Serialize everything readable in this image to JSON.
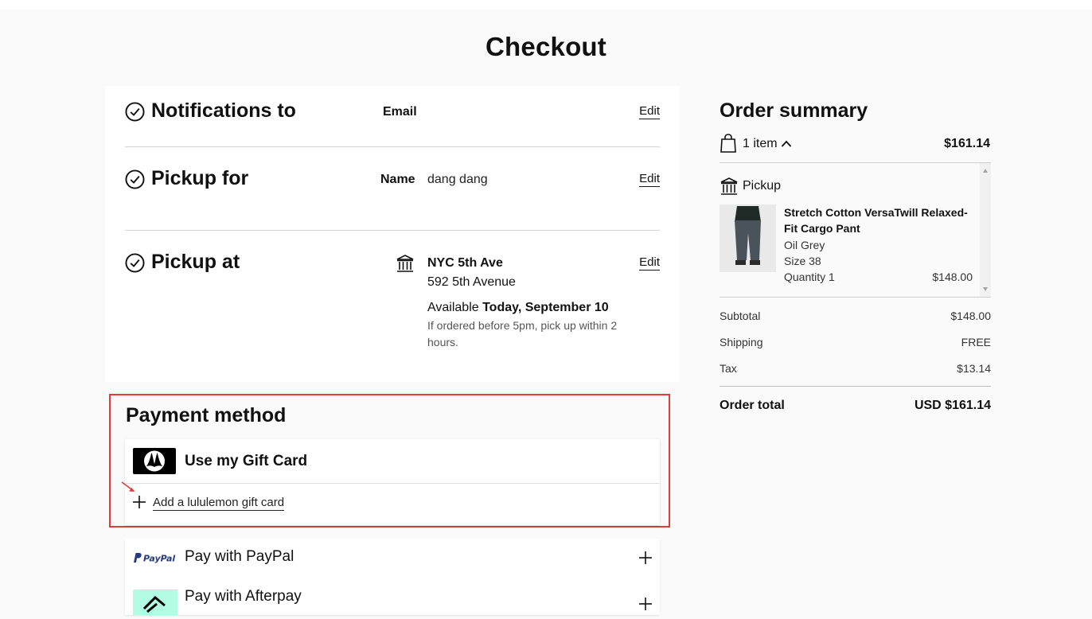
{
  "page": {
    "title": "Checkout"
  },
  "notifications": {
    "title": "Notifications to",
    "label": "Email",
    "edit": "Edit"
  },
  "pickup_for": {
    "title": "Pickup for",
    "label": "Name",
    "value": "dang dang",
    "edit": "Edit"
  },
  "pickup_at": {
    "title": "Pickup at",
    "store_name": "NYC 5th Ave",
    "address": "592 5th Avenue",
    "available_prefix": "Available",
    "available_when": "Today, September 10",
    "note": "If ordered before 5pm, pick up within 2 hours.",
    "edit": "Edit"
  },
  "payment": {
    "title": "Payment method",
    "gift_card": {
      "title": "Use my Gift Card",
      "add_link": "Add a lululemon gift card"
    },
    "options": [
      {
        "label": "Pay with PayPal",
        "logo_text": "PayPal"
      },
      {
        "label": "Pay with Afterpay"
      }
    ]
  },
  "summary": {
    "title": "Order summary",
    "item_count": "1 item",
    "total_top": "$161.14",
    "pickup_label": "Pickup",
    "product": {
      "name": "Stretch Cotton VersaTwill Relaxed-Fit Cargo Pant",
      "color": "Oil Grey",
      "size": "Size 38",
      "quantity": "Quantity 1",
      "price": "$148.00"
    },
    "rows": [
      {
        "label": "Subtotal",
        "value": "$148.00"
      },
      {
        "label": "Shipping",
        "value": "FREE"
      },
      {
        "label": "Tax",
        "value": "$13.14"
      }
    ],
    "order_total_label": "Order total",
    "order_total_value": "USD $161.14"
  },
  "colors": {
    "highlight_border": "#e03c3c",
    "afterpay_mint": "#b2fce4",
    "paypal_blue": "#253b80"
  }
}
